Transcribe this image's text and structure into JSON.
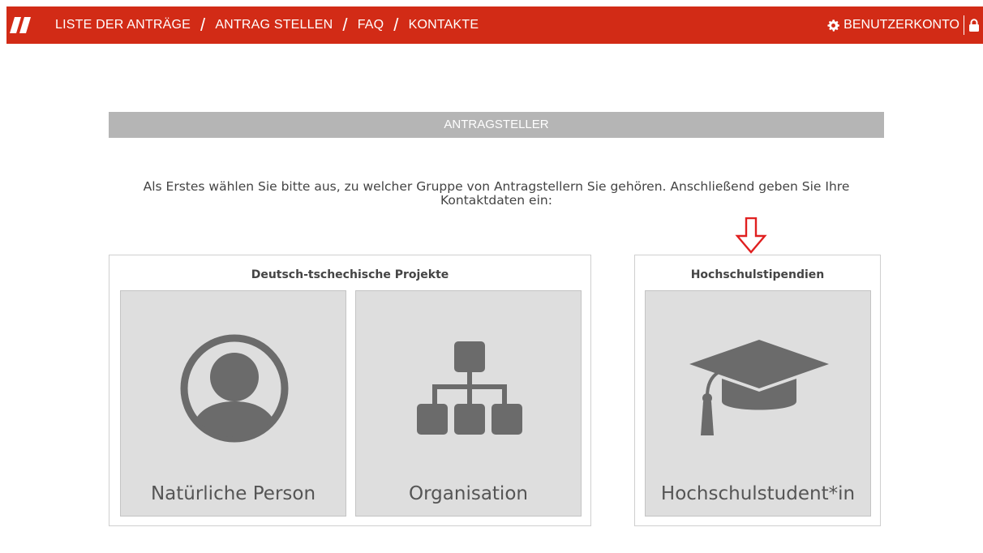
{
  "nav": {
    "items": [
      {
        "label": "LISTE DER ANTRÄGE"
      },
      {
        "label": "ANTRAG STELLEN"
      },
      {
        "label": "FAQ"
      },
      {
        "label": "KONTAKTE"
      }
    ],
    "separator": "/",
    "account_label": "BENUTZERKONTO"
  },
  "section": {
    "header": "ANTRAGSTELLER",
    "intro": "Als Erstes wählen Sie bitte aus, zu welcher Gruppe von Antragstellern Sie gehören. Anschließend geben Sie Ihre Kontaktdaten ein:"
  },
  "groups": [
    {
      "title": "Deutsch-tschechische Projekte",
      "tiles": [
        {
          "label": "Natürliche Person",
          "icon": "person-icon"
        },
        {
          "label": "Organisation",
          "icon": "org-chart-icon"
        }
      ]
    },
    {
      "title": "Hochschulstipendien",
      "tiles": [
        {
          "label": "Hochschulstudent*in",
          "icon": "graduation-cap-icon"
        }
      ]
    }
  ],
  "colors": {
    "brand_red": "#d22b16",
    "header_gray": "#b5b5b5",
    "tile_bg": "#dedede",
    "icon_gray": "#6b6b6b",
    "arrow_red": "#e02020"
  }
}
